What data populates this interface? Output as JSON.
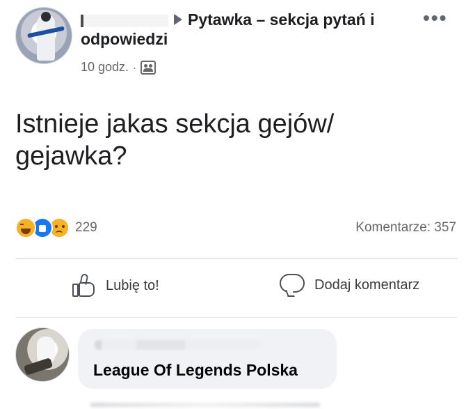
{
  "header": {
    "group_name": "Pytawka – sekcja pytań i odpowiedzi",
    "timestamp": "10 godz.",
    "separator": "·"
  },
  "post": {
    "text": "Istnieje jakas sekcja gejów/ gejawka?"
  },
  "reactions": {
    "types": [
      "haha-icon",
      "like-icon",
      "sad-icon"
    ],
    "count": "229"
  },
  "comments_count_label": "Komentarze: 357",
  "actions": {
    "like_label": "Lubię to!",
    "comment_label": "Dodaj komentarz"
  },
  "comment": {
    "text": "League Of Legends Polska"
  },
  "more_label": "•••",
  "colors": {
    "text_primary": "#1c1e21",
    "text_secondary": "#65676b",
    "like_blue": "#1877f2",
    "emoji_yellow": "#f7b125",
    "comment_bg": "#f0f2f5",
    "divider": "#ced0d4"
  }
}
